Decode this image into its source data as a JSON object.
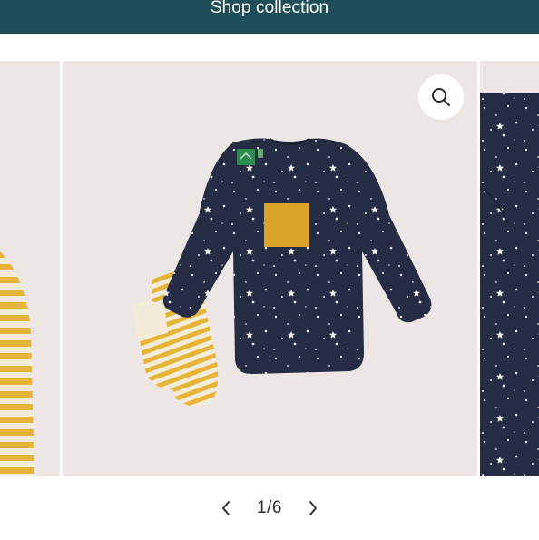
{
  "header": {
    "shop_collection_label": "Shop collection"
  },
  "pager": {
    "current": 1,
    "total": 6,
    "text": "1/6"
  },
  "colors": {
    "header_bg": "#1f4e59",
    "slide_bg": "#ece7e5",
    "navy": "#262c44",
    "mustard": "#dca32b",
    "stripe": "#e7b43a",
    "cream": "#f3ecd8",
    "label_green": "#2e8b4f"
  },
  "icons": {
    "zoom": "magnifier-icon",
    "prev": "chevron-left-icon",
    "next": "chevron-right-icon"
  }
}
